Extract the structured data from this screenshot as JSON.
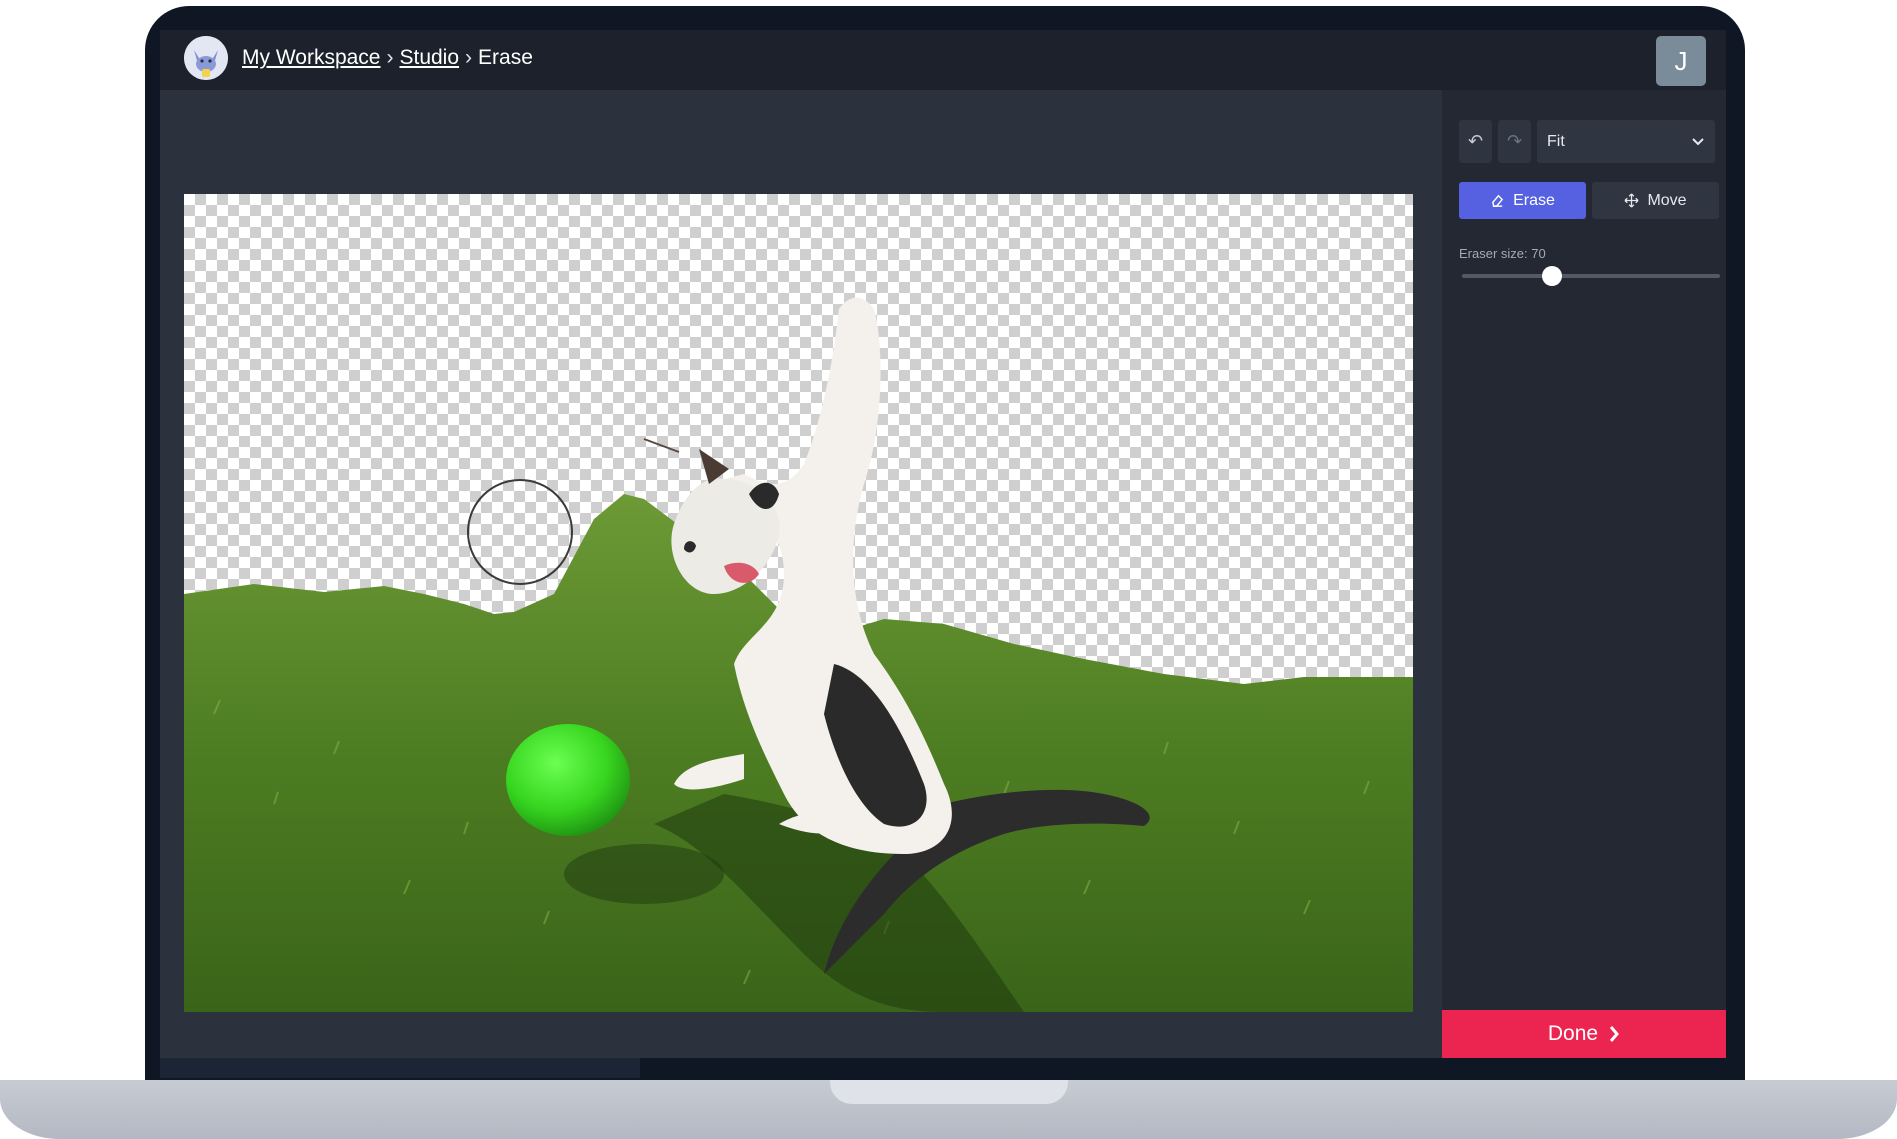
{
  "breadcrumb": {
    "workspace": "My Workspace",
    "separator": "›",
    "studio": "Studio",
    "current": "Erase"
  },
  "user": {
    "initial": "J"
  },
  "toolbar": {
    "undo_icon": "undo-icon",
    "redo_icon": "redo-icon",
    "zoom_selected": "Fit"
  },
  "modes": {
    "erase_label": "Erase",
    "move_label": "Move",
    "active": "Erase"
  },
  "eraser": {
    "label": "Eraser size: 70",
    "value": 70,
    "min": 0,
    "max": 200
  },
  "done_label": "Done",
  "colors": {
    "accent": "#5561e0",
    "done": "#ec2450",
    "topbar": "#1c212b",
    "panel": "#232833"
  }
}
